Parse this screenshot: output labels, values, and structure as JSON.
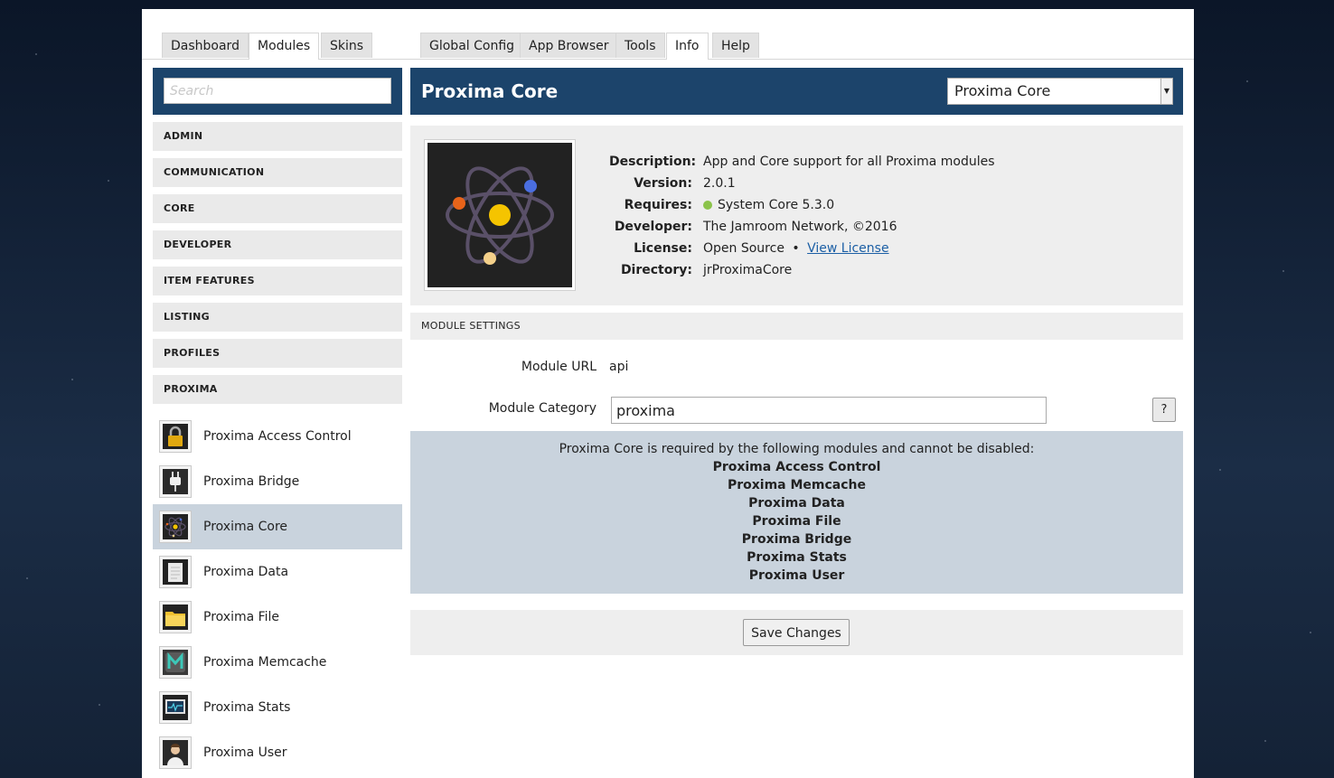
{
  "tabs_left": [
    "Dashboard",
    "Modules",
    "Skins"
  ],
  "tabs_right": [
    "Global Config",
    "App Browser",
    "Tools",
    "Info",
    "Help"
  ],
  "active_tabs": [
    "Modules",
    "Info"
  ],
  "sidebar": {
    "search_placeholder": "Search",
    "categories": [
      "ADMIN",
      "COMMUNICATION",
      "CORE",
      "DEVELOPER",
      "ITEM FEATURES",
      "LISTING",
      "PROFILES",
      "PROXIMA"
    ],
    "modules": [
      {
        "label": "Proxima Access Control",
        "icon": "lock-icon"
      },
      {
        "label": "Proxima Bridge",
        "icon": "plug-icon"
      },
      {
        "label": "Proxima Core",
        "icon": "atom-icon",
        "active": true
      },
      {
        "label": "Proxima Data",
        "icon": "document-icon"
      },
      {
        "label": "Proxima File",
        "icon": "folder-icon"
      },
      {
        "label": "Proxima Memcache",
        "icon": "memcache-m-icon"
      },
      {
        "label": "Proxima Stats",
        "icon": "monitor-icon"
      },
      {
        "label": "Proxima User",
        "icon": "user-icon"
      }
    ]
  },
  "header": {
    "title": "Proxima Core",
    "select_value": "Proxima Core"
  },
  "info": {
    "description_label": "Description:",
    "description": "App and Core support for all Proxima modules",
    "version_label": "Version:",
    "version": "2.0.1",
    "requires_label": "Requires:",
    "requires": "System Core 5.3.0",
    "developer_label": "Developer:",
    "developer": "The Jamroom Network, ©2016",
    "license_label": "License:",
    "license": "Open Source",
    "license_sep": "•",
    "license_link": "View License",
    "directory_label": "Directory:",
    "directory": "jrProximaCore"
  },
  "settings": {
    "section_title": "MODULE SETTINGS",
    "url_label": "Module URL",
    "url_value": "api",
    "category_label": "Module Category",
    "category_value": "proxima",
    "help_label": "?"
  },
  "notice": {
    "text": "Proxima Core is required by the following modules and cannot be disabled:",
    "modules": [
      "Proxima Access Control",
      "Proxima Memcache",
      "Proxima Data",
      "Proxima File",
      "Proxima Bridge",
      "Proxima Stats",
      "Proxima User"
    ]
  },
  "save_label": "Save Changes",
  "colors": {
    "header_blue": "#1c446b",
    "active_row": "#c9d3dd",
    "status_green": "#8bc34a",
    "link": "#1c5fa5"
  }
}
